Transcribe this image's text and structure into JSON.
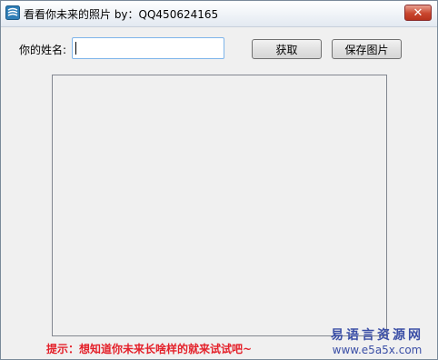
{
  "window": {
    "title": "看看你未来的照片 by：QQ450624165",
    "close_symbol": "✕"
  },
  "form": {
    "name_label": "你的姓名:",
    "name_value": "",
    "get_button": "获取",
    "save_button": "保存图片"
  },
  "hint": "提示：想知道你未来长啥样的就来试试吧~",
  "watermark": {
    "text": "易语言资源网",
    "url": "www.e5a5x.com"
  },
  "colors": {
    "hint": "#e4212a",
    "watermark": "#3b4fa6",
    "input_border": "#7eb4ea"
  }
}
